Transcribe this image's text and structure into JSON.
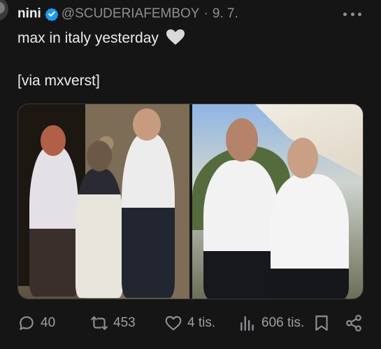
{
  "post": {
    "display_name": "nini",
    "handle": "@SCUDERIAFEMBOY",
    "separator": "·",
    "date": "9. 7.",
    "text_line1": "max in italy yesterday",
    "text_line2": "[via mxverst]"
  },
  "actions": {
    "replies": "40",
    "reposts": "453",
    "likes": "4 tis.",
    "views": "606 tis."
  },
  "colors": {
    "background": "#151515",
    "text": "#e7e9ea",
    "muted": "#8b8f94",
    "verified": "#1d9bf0"
  },
  "icons": [
    "verified-badge-icon",
    "more-icon",
    "white-heart-emoji",
    "reply-icon",
    "repost-icon",
    "like-icon",
    "views-icon",
    "bookmark-icon",
    "share-icon"
  ]
}
